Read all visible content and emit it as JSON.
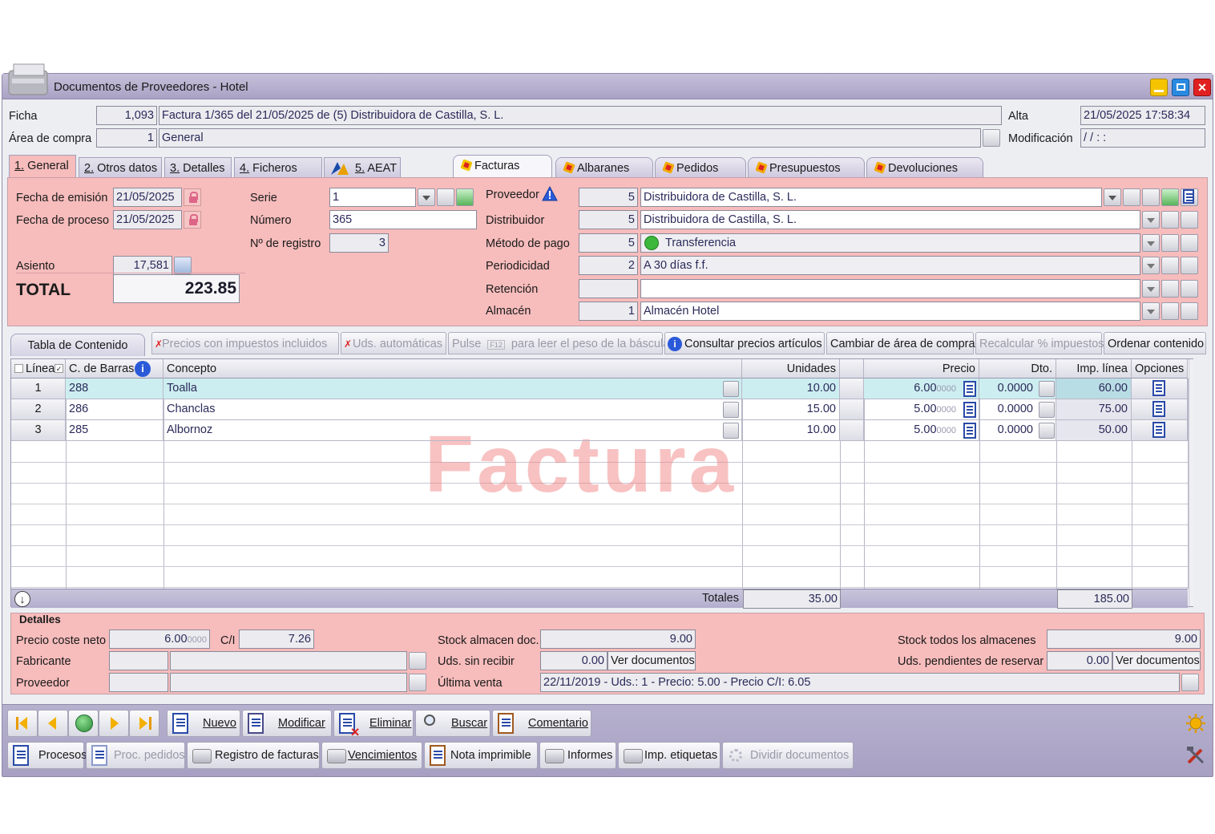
{
  "window": {
    "title": "Documentos de Proveedores - Hotel"
  },
  "header": {
    "ficha_label": "Ficha",
    "ficha_value": "1,093",
    "ficha_desc": "Factura 1/365 del 21/05/2025 de (5) Distribuidora de Castilla, S. L.",
    "area_label": "Área de compra",
    "area_value": "1",
    "area_desc": "General",
    "alta_label": "Alta",
    "alta_value": "21/05/2025  17:58:34",
    "mod_label": "Modificación",
    "mod_value": " /   /            :    :"
  },
  "tabs_left": [
    {
      "num": "1.",
      "label": " General"
    },
    {
      "num": "2.",
      "label": " Otros datos"
    },
    {
      "num": "3.",
      "label": " Detalles"
    },
    {
      "num": "4.",
      "label": " Ficheros"
    },
    {
      "num": "5.",
      "label": " AEAT"
    }
  ],
  "tabs_right": [
    "Facturas",
    "Albaranes",
    "Pedidos",
    "Presupuestos",
    "Devoluciones"
  ],
  "general": {
    "fecha_emision_label": "Fecha de emisión",
    "fecha_emision": "21/05/2025",
    "fecha_proceso_label": "Fecha de proceso",
    "fecha_proceso": "21/05/2025",
    "asiento_label": "Asiento",
    "asiento": "17,581",
    "total_label": "TOTAL",
    "total": "223.85",
    "serie_label": "Serie",
    "serie": "1",
    "numero_label": "Número",
    "numero": "365",
    "registro_label": "Nº de registro",
    "registro": "3"
  },
  "proveedor": {
    "proveedor_label": "Proveedor",
    "proveedor_code": "5",
    "proveedor_name": "Distribuidora de Castilla, S. L.",
    "distribuidor_label": "Distribuidor",
    "distribuidor_code": "5",
    "distribuidor_name": "Distribuidora de Castilla, S. L.",
    "metodo_label": "Método de pago",
    "metodo_code": "5",
    "metodo_name": "Transferencia",
    "periodicidad_label": "Periodicidad",
    "periodicidad_code": "2",
    "periodicidad_name": "A 30 días f.f.",
    "retencion_label": "Retención",
    "retencion_code": "",
    "retencion_name": "",
    "almacen_label": "Almacén",
    "almacen_code": "1",
    "almacen_name": "Almacén Hotel"
  },
  "content_toolbar": {
    "tab_label": "Tabla de Contenido",
    "precios_impuestos": "Precios con impuestos incluidos",
    "uds_auto": "Uds. automáticas",
    "pulse": "Pulse",
    "f12": "F12",
    "bascula": "para leer el peso de la báscula",
    "consultar": "Consultar precios artículos",
    "cambiar_area": "Cambiar de área de compra",
    "recalcular": "Recalcular % impuestos",
    "ordenar": "Ordenar contenido"
  },
  "table": {
    "columns": [
      "Línea",
      "C. de Barras",
      "Concepto",
      "Unidades",
      "Precio",
      "Dto.",
      "Imp. línea",
      "Opciones"
    ],
    "rows": [
      {
        "linea": "1",
        "barras": "288",
        "concepto": "Toalla",
        "unidades": "10.00",
        "precio": "6.00",
        "precio_dec": "0000",
        "dto": "0.0000",
        "imp": "60.00"
      },
      {
        "linea": "2",
        "barras": "286",
        "concepto": "Chanclas",
        "unidades": "15.00",
        "precio": "5.00",
        "precio_dec": "0000",
        "dto": "0.0000",
        "imp": "75.00"
      },
      {
        "linea": "3",
        "barras": "285",
        "concepto": "Albornoz",
        "unidades": "10.00",
        "precio": "5.00",
        "precio_dec": "0000",
        "dto": "0.0000",
        "imp": "50.00"
      }
    ],
    "totales_label": "Totales",
    "total_unidades": "35.00",
    "total_imp": "185.00",
    "watermark": "Factura"
  },
  "detalles": {
    "title": "Detalles",
    "precio_coste_label": "Precio coste neto",
    "precio_coste": "6.00",
    "precio_coste_dec": "0000",
    "ci_label": "C/I",
    "ci": "7.26",
    "fabricante_label": "Fabricante",
    "proveedor_label": "Proveedor",
    "stock_doc_label": "Stock almacen doc.",
    "stock_doc": "9.00",
    "sin_recibir_label": "Uds. sin recibir",
    "sin_recibir": "0.00",
    "ver_docs": "Ver documentos",
    "ultima_venta_label": "Última venta",
    "ultima_venta": "22/11/2019 - Uds.: 1 - Precio: 5.00 - Precio C/I: 6.05",
    "stock_todos_label": "Stock todos los almacenes",
    "stock_todos": "9.00",
    "pend_reservar_label": "Uds. pendientes de reservar",
    "pend_reservar": "0.00",
    "ver_docs2": "Ver documentos"
  },
  "actions": {
    "nuevo": "Nuevo",
    "modificar": "Modificar",
    "eliminar": "Eliminar",
    "buscar": "Buscar",
    "comentario": "Comentario",
    "procesos": "Procesos",
    "proc_pedidos": "Proc. pedidos",
    "registro_facturas": "Registro de facturas",
    "vencimientos": "Vencimientos",
    "nota_imprimible": "Nota imprimible",
    "informes": "Informes",
    "imp_etiquetas": "Imp. etiquetas",
    "dividir": "Dividir documentos"
  },
  "colors": {
    "pink_panel": "#f7bcbc",
    "selected_row": "#cdeef0",
    "title_bar": "#aaa2c4",
    "link_text": "#2a2a5a"
  }
}
